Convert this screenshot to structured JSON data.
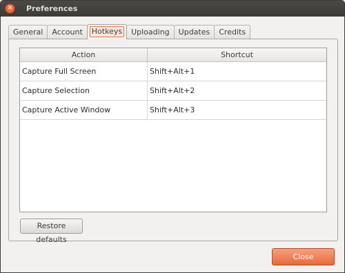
{
  "window": {
    "title": "Preferences",
    "close_glyph": "✕"
  },
  "tabs": [
    {
      "label": "General",
      "active": false
    },
    {
      "label": "Account",
      "active": false
    },
    {
      "label": "Hotkeys",
      "active": true
    },
    {
      "label": "Uploading",
      "active": false
    },
    {
      "label": "Updates",
      "active": false
    },
    {
      "label": "Credits",
      "active": false
    }
  ],
  "hotkeys_table": {
    "columns": [
      "Action",
      "Shortcut"
    ],
    "rows": [
      {
        "action": "Capture Full Screen",
        "shortcut": "Shift+Alt+1"
      },
      {
        "action": "Capture Selection",
        "shortcut": "Shift+Alt+2"
      },
      {
        "action": "Capture Active Window",
        "shortcut": "Shift+Alt+3"
      }
    ]
  },
  "buttons": {
    "restore_defaults": "Restore defaults",
    "close": "Close"
  },
  "colors": {
    "accent": "#e8693a",
    "titlebar": "#3c3b37"
  }
}
